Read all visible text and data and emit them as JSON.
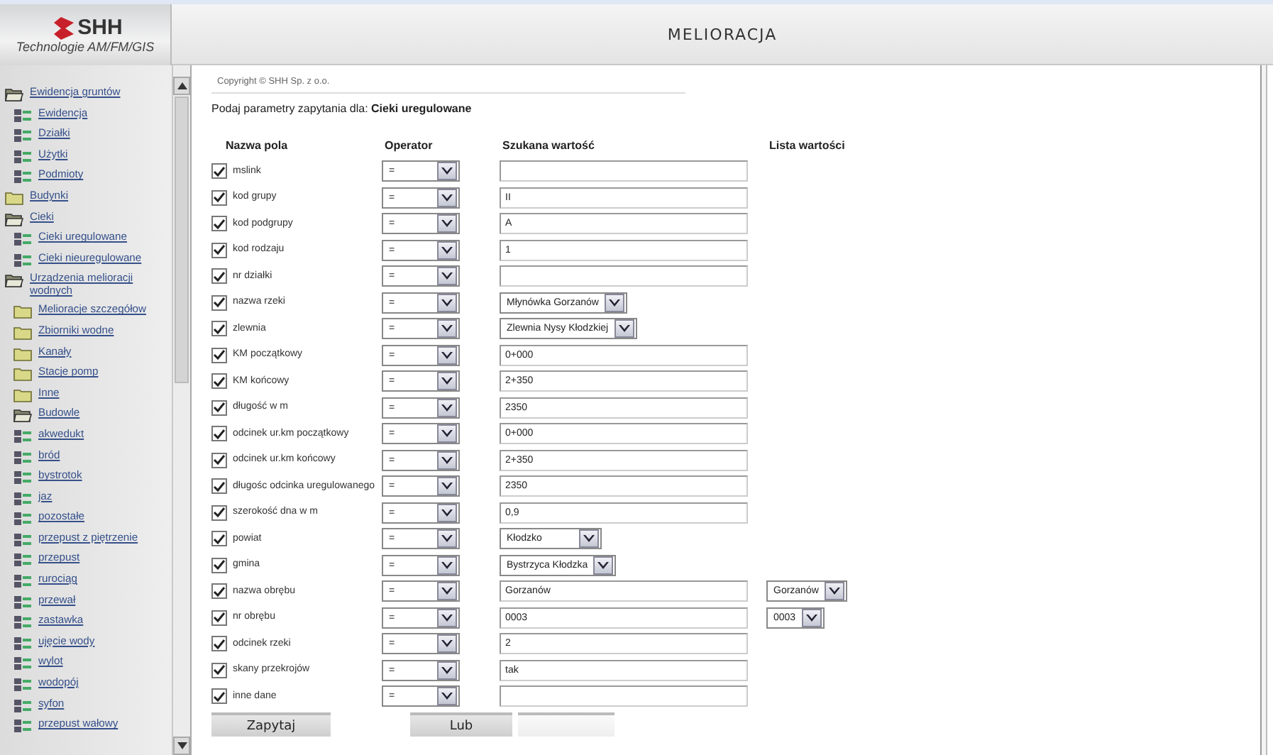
{
  "logo": {
    "name": "SHH",
    "tagline": "Technologie AM/FM/GIS"
  },
  "title": "MELIORACJA",
  "copyright": "Copyright © SHH Sp. z o.o.",
  "prompt": "Podaj parametry zapytania dla: **Cieki uregulowane**",
  "sidebar": {
    "items": [
      {
        "label": "Ewidencja gruntów",
        "kind": "folder",
        "expanded": true,
        "children": [
          {
            "label": "Ewidencja",
            "kind": "layer"
          },
          {
            "label": "Działki",
            "kind": "layer"
          },
          {
            "label": "Użytki",
            "kind": "layer"
          },
          {
            "label": "Podmioty",
            "kind": "layer"
          }
        ]
      },
      {
        "label": "Budynki",
        "kind": "folder",
        "expanded": false
      },
      {
        "label": "Cieki",
        "kind": "folder",
        "expanded": true,
        "children": [
          {
            "label": "Cieki uregulowane",
            "kind": "layer"
          },
          {
            "label": "Cieki nieuregulowane",
            "kind": "layer"
          }
        ]
      },
      {
        "label": "Urządzenia melioracji wodnych",
        "kind": "folder",
        "expanded": true,
        "children": [
          {
            "label": "Melioracje szczegółow",
            "kind": "folder",
            "expanded": false
          },
          {
            "label": "Zbiorniki wodne",
            "kind": "folder",
            "expanded": false
          },
          {
            "label": "Kanały",
            "kind": "folder",
            "expanded": false
          },
          {
            "label": "Stacje pomp",
            "kind": "folder",
            "expanded": false
          },
          {
            "label": "Inne",
            "kind": "folder",
            "expanded": false
          },
          {
            "label": "Budowle",
            "kind": "folder",
            "expanded": true
          },
          {
            "label": "akwedukt",
            "kind": "layer"
          },
          {
            "label": "bród",
            "kind": "layer"
          },
          {
            "label": "bystrotok",
            "kind": "layer"
          },
          {
            "label": "jaz",
            "kind": "layer"
          },
          {
            "label": "pozostałe",
            "kind": "layer"
          },
          {
            "label": "przepust z piętrzenie",
            "kind": "layer"
          },
          {
            "label": "przepust",
            "kind": "layer"
          },
          {
            "label": "rurociąg",
            "kind": "layer"
          },
          {
            "label": "przewał",
            "kind": "layer"
          },
          {
            "label": "zastawka",
            "kind": "layer"
          },
          {
            "label": "ujęcie wody",
            "kind": "layer"
          },
          {
            "label": "wylot",
            "kind": "layer"
          },
          {
            "label": "wodopój",
            "kind": "layer"
          },
          {
            "label": "syfon",
            "kind": "layer"
          },
          {
            "label": "przepust wałowy",
            "kind": "layer"
          }
        ]
      }
    ]
  },
  "form": {
    "columns": [
      "Nazwa pola",
      "Operator",
      "Szukana wartość",
      "Lista wartości"
    ],
    "rows": [
      {
        "field": "mslink",
        "checked": true,
        "operator": "=",
        "kind": "text"
      },
      {
        "field": "kod grupy",
        "checked": true,
        "operator": "=",
        "value": "II",
        "kind": "text"
      },
      {
        "field": "kod podgrupy",
        "checked": true,
        "operator": "=",
        "value": "A",
        "kind": "text"
      },
      {
        "field": "kod rodzaju",
        "checked": true,
        "operator": "=",
        "value": "1",
        "kind": "text"
      },
      {
        "field": "nr działki",
        "checked": true,
        "operator": "=",
        "kind": "text"
      },
      {
        "field": "nazwa rzeki",
        "checked": true,
        "operator": "=",
        "value": "Młynówka Gorzanów",
        "kind": "select"
      },
      {
        "field": "zlewnia",
        "checked": true,
        "operator": "=",
        "value": "Zlewnia Nysy Kłodzkiej",
        "kind": "select"
      },
      {
        "field": "KM początkowy",
        "checked": true,
        "operator": "=",
        "value": "0+000",
        "kind": "text"
      },
      {
        "field": "KM końcowy",
        "checked": true,
        "operator": "=",
        "value": "2+350",
        "kind": "text"
      },
      {
        "field": "długość w m",
        "checked": true,
        "operator": "=",
        "value": "2350",
        "kind": "text"
      },
      {
        "field": "odcinek ur.km początkowy",
        "checked": true,
        "operator": "=",
        "value": "0+000",
        "kind": "text"
      },
      {
        "field": "odcinek ur.km końcowy",
        "checked": true,
        "operator": "=",
        "value": "2+350",
        "kind": "text"
      },
      {
        "field": "długośc odcinka uregulowanego",
        "checked": true,
        "operator": "=",
        "value": "2350",
        "kind": "text"
      },
      {
        "field": "szerokość dna w m",
        "checked": true,
        "operator": "=",
        "value": "0,9",
        "kind": "text"
      },
      {
        "field": "powiat",
        "checked": true,
        "operator": "=",
        "value": "Kłodzko",
        "kind": "select"
      },
      {
        "field": "gmina",
        "checked": true,
        "operator": "=",
        "value": "Bystrzyca Kłodzka",
        "kind": "select"
      },
      {
        "field": "nazwa obrębu",
        "checked": true,
        "operator": "=",
        "value": "Gorzanów",
        "kind": "text",
        "list": "Gorzanów"
      },
      {
        "field": "nr obrębu",
        "checked": true,
        "operator": "=",
        "value": "0003",
        "kind": "text",
        "list": "0003"
      },
      {
        "field": "odcinek rzeki",
        "checked": true,
        "operator": "=",
        "value": "2",
        "kind": "text"
      },
      {
        "field": "skany przekrojów",
        "checked": true,
        "operator": "=",
        "value": "tak",
        "kind": "text"
      },
      {
        "field": "inne dane",
        "checked": true,
        "operator": "=",
        "kind": "text"
      }
    ]
  },
  "buttons": [
    {
      "label": "Zapytaj",
      "kind": "raised"
    },
    {
      "label": "Lub",
      "kind": "raised"
    },
    {
      "kind": "blank"
    }
  ]
}
